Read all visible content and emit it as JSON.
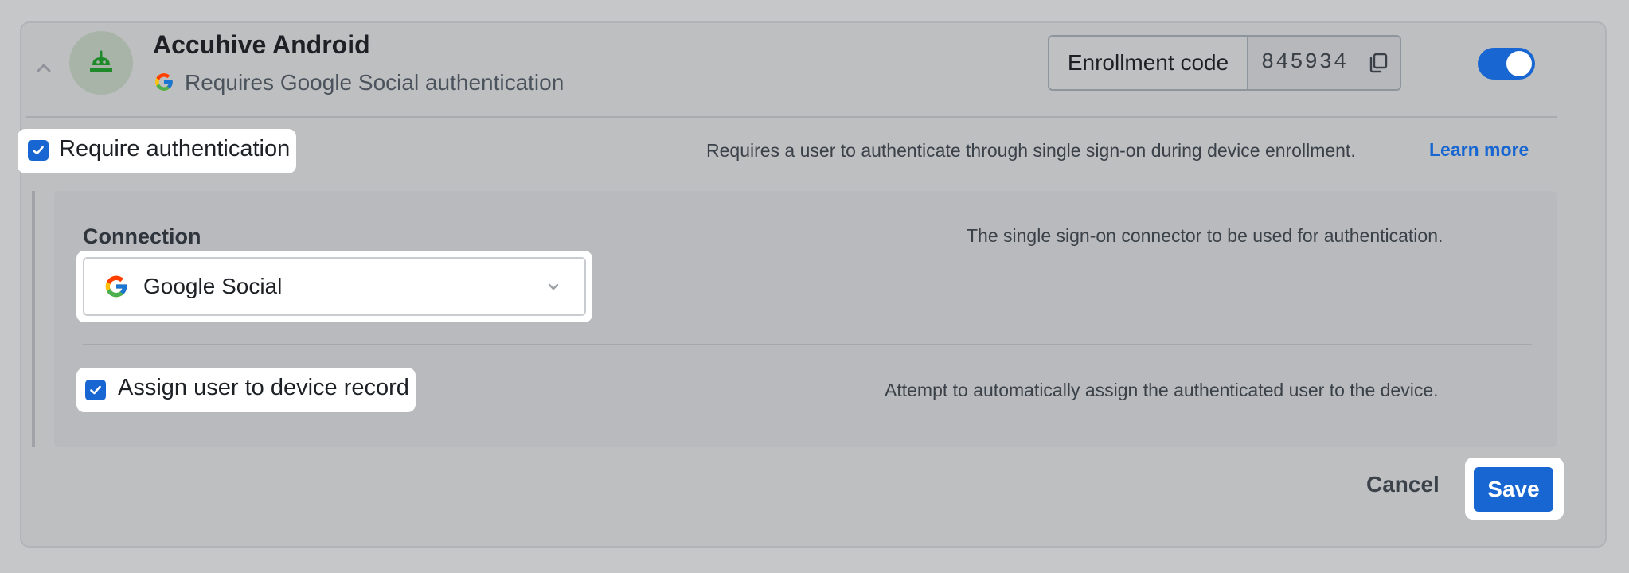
{
  "app": {
    "title": "Accuhive Android",
    "subtitle": "Requires Google Social authentication",
    "avatar_icon": "android-robot-icon"
  },
  "enrollment": {
    "label": "Enrollment code",
    "code": "845934",
    "copy_icon": "copy-icon"
  },
  "toggle": {
    "enabled": true
  },
  "require_auth": {
    "label": "Require authentication",
    "checked": true,
    "description": "Requires a user to authenticate through single sign-on during device enrollment.",
    "learn_more": "Learn more"
  },
  "connection": {
    "label": "Connection",
    "description": "The single sign-on connector to be used for authentication.",
    "selected": "Google Social"
  },
  "assign_user": {
    "label": "Assign user to device record",
    "checked": true,
    "description": "Attempt to automatically assign the authenticated user to the device."
  },
  "footer": {
    "cancel_label": "Cancel",
    "save_label": "Save"
  },
  "colors": {
    "accent": "#1766d1",
    "android_green": "#1e8a2a"
  }
}
